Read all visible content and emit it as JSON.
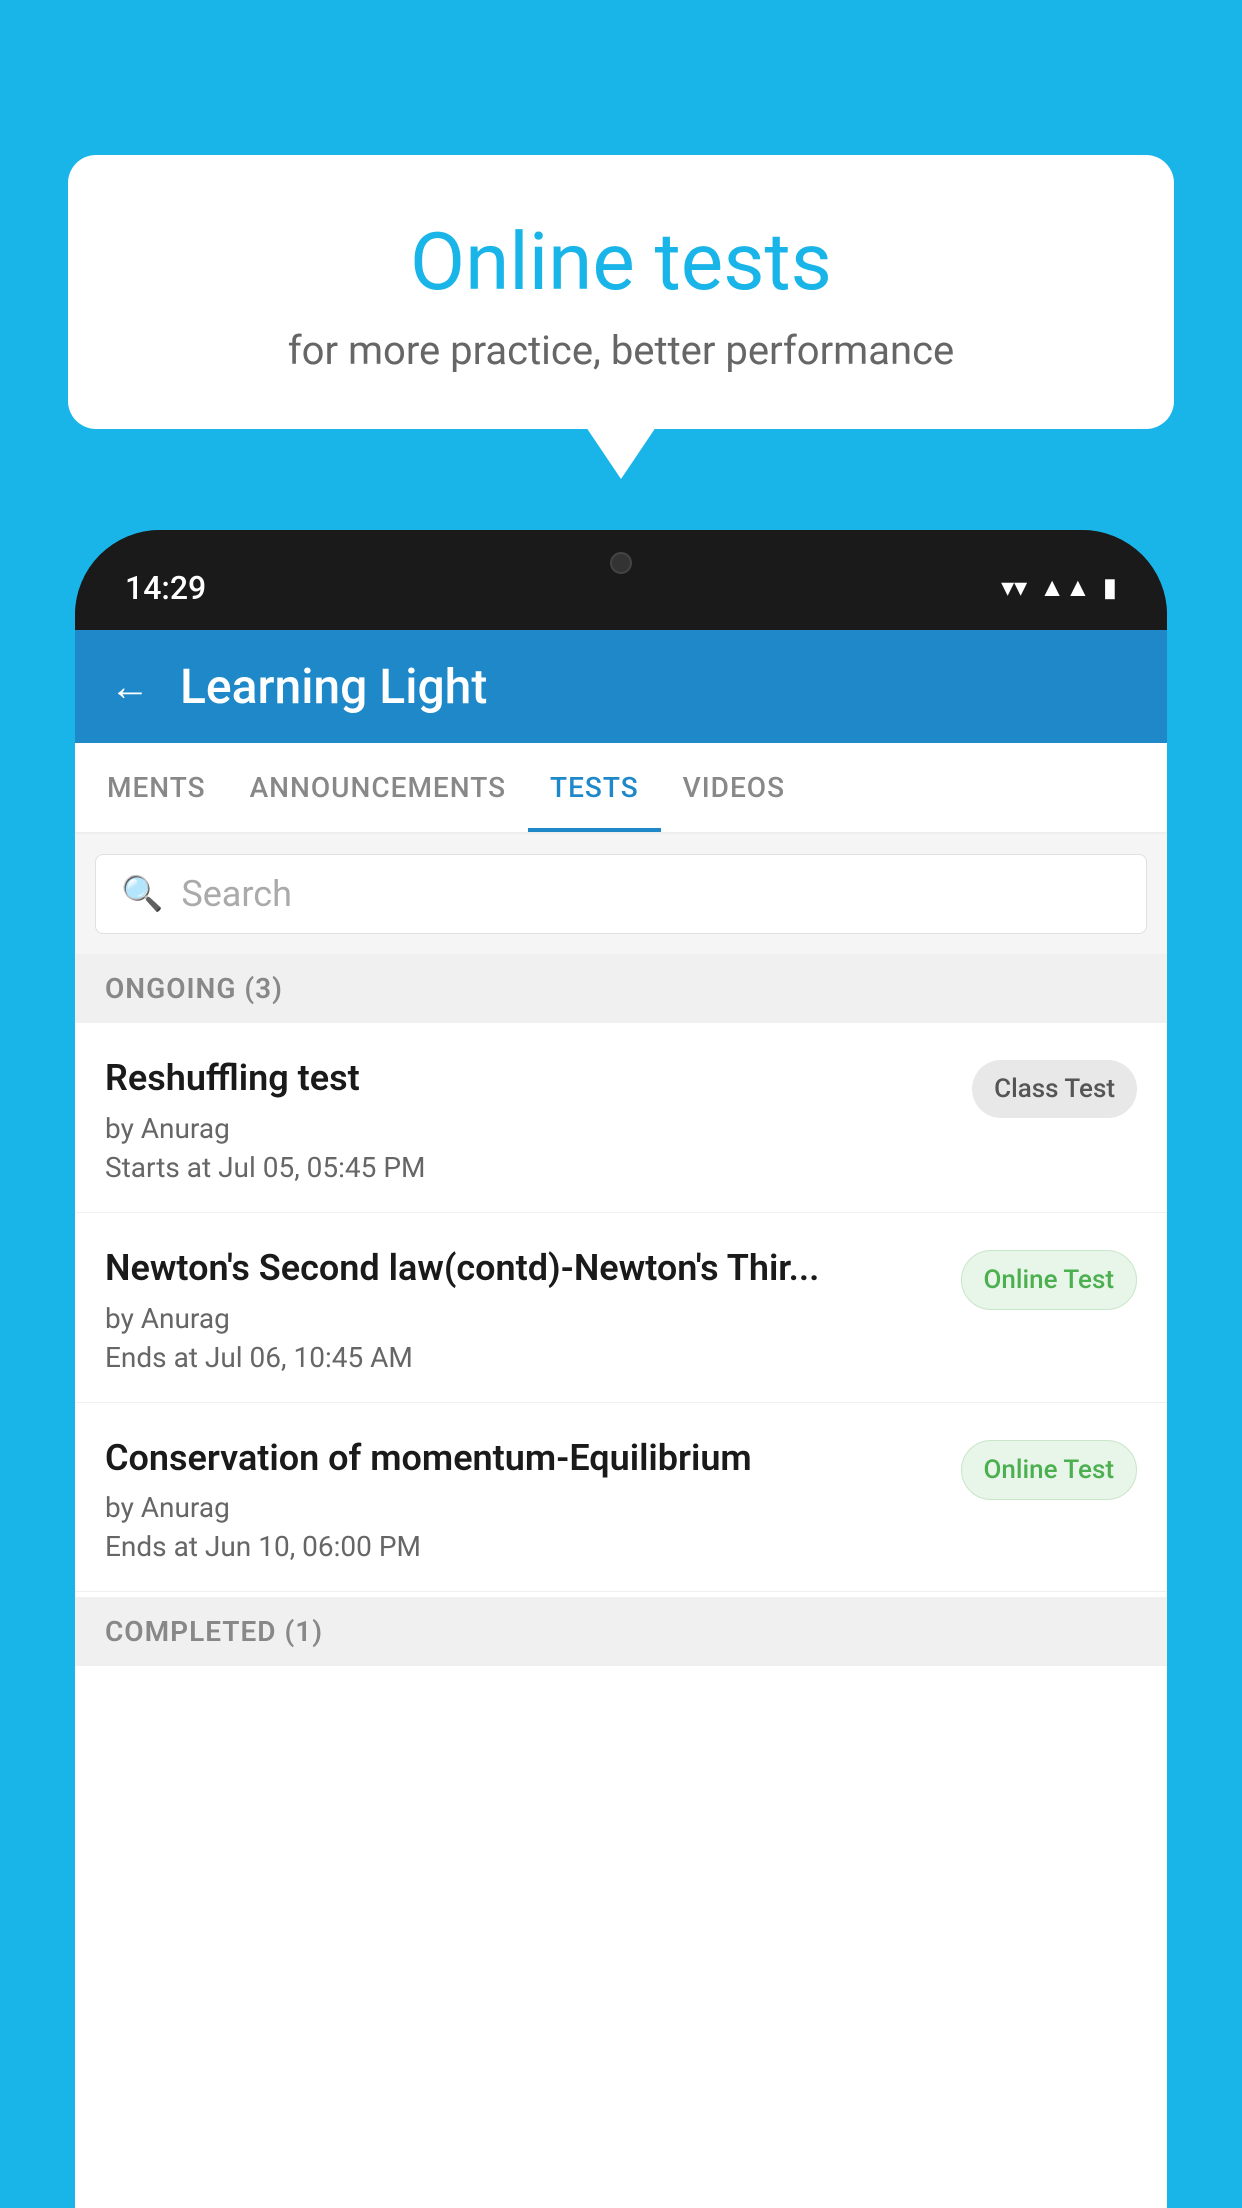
{
  "background": {
    "color": "#1ab5e8"
  },
  "speech_bubble": {
    "title": "Online tests",
    "subtitle": "for more practice, better performance"
  },
  "phone": {
    "status_bar": {
      "time": "14:29",
      "wifi_icon": "wifi",
      "signal_icon": "signal",
      "battery_icon": "battery"
    },
    "app_header": {
      "back_label": "←",
      "title": "Learning Light"
    },
    "tabs": [
      {
        "label": "MENTS",
        "active": false
      },
      {
        "label": "ANNOUNCEMENTS",
        "active": false
      },
      {
        "label": "TESTS",
        "active": true
      },
      {
        "label": "VIDEOS",
        "active": false
      }
    ],
    "search": {
      "placeholder": "Search",
      "icon": "search"
    },
    "section_ongoing": {
      "label": "ONGOING (3)"
    },
    "test_items": [
      {
        "name": "Reshuffling test",
        "author": "by Anurag",
        "date_label": "Starts at",
        "date": "Jul 05, 05:45 PM",
        "badge": "Class Test",
        "badge_type": "class"
      },
      {
        "name": "Newton's Second law(contd)-Newton's Thir...",
        "author": "by Anurag",
        "date_label": "Ends at",
        "date": "Jul 06, 10:45 AM",
        "badge": "Online Test",
        "badge_type": "online"
      },
      {
        "name": "Conservation of momentum-Equilibrium",
        "author": "by Anurag",
        "date_label": "Ends at",
        "date": "Jun 10, 06:00 PM",
        "badge": "Online Test",
        "badge_type": "online"
      }
    ],
    "section_completed": {
      "label": "COMPLETED (1)"
    }
  }
}
